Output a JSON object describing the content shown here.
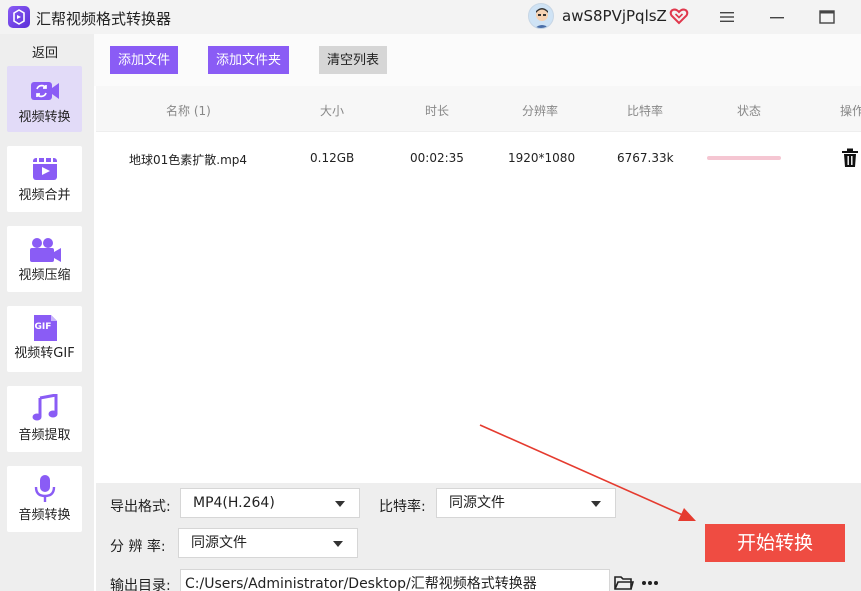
{
  "window": {
    "title": "汇帮视频格式转换器",
    "username": "awS8PVjPqlsZ"
  },
  "sidebar": {
    "back_label": "返回",
    "items": [
      {
        "label": "视频转换",
        "icon": "video-convert-icon",
        "active": true
      },
      {
        "label": "视频合并",
        "icon": "video-merge-icon",
        "active": false
      },
      {
        "label": "视频压缩",
        "icon": "video-compress-icon",
        "active": false
      },
      {
        "label": "视频转GIF",
        "icon": "gif-icon",
        "active": false
      },
      {
        "label": "音频提取",
        "icon": "music-note-icon",
        "active": false
      },
      {
        "label": "音频转换",
        "icon": "microphone-icon",
        "active": false
      }
    ],
    "gif_badge": "GIF"
  },
  "toolbar": {
    "add_file": "添加文件",
    "add_folder": "添加文件夹",
    "clear_list": "清空列表"
  },
  "table": {
    "headers": [
      "名称 (1)",
      "大小",
      "时长",
      "分辨率",
      "比特率",
      "状态",
      "操作"
    ],
    "rows": [
      {
        "name": "地球01色素扩散.mp4",
        "size": "0.12GB",
        "duration": "00:02:35",
        "resolution": "1920*1080",
        "bitrate": "6767.33k"
      }
    ]
  },
  "settings": {
    "format_label": "导出格式:",
    "format_value": "MP4(H.264)",
    "bitrate_label": "比特率:",
    "bitrate_value": "同源文件",
    "resolution_label": "分 辨 率:",
    "resolution_value": "同源文件",
    "output_label": "输出目录:",
    "output_path": "C:/Users/Administrator/Desktop/汇帮视频格式转换器"
  },
  "actions": {
    "start": "开始转换"
  },
  "colors": {
    "accent": "#8a5cf5",
    "start": "#ef4c42",
    "arrow": "#e53b2f"
  }
}
